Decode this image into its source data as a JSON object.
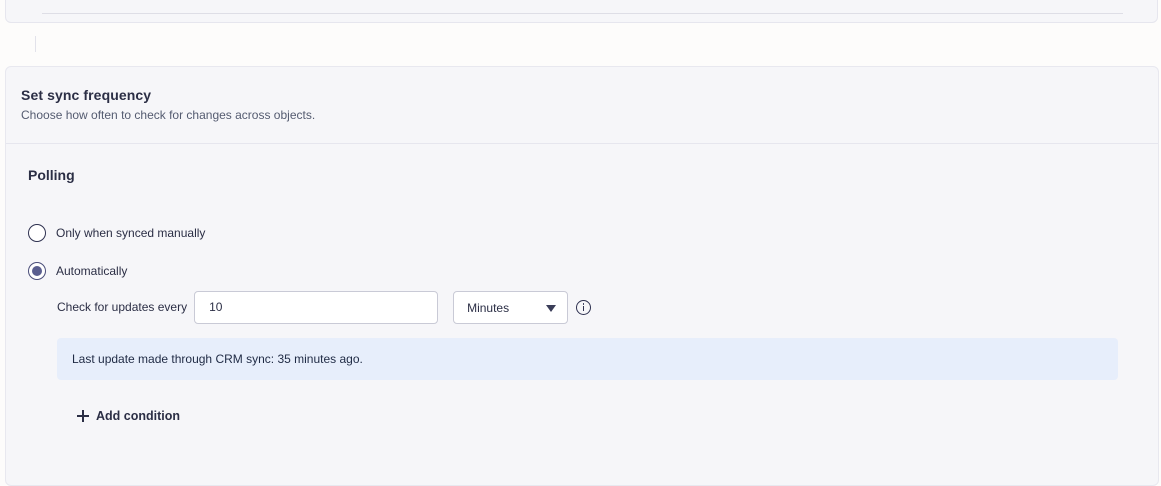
{
  "sync": {
    "title": "Set sync frequency",
    "subtitle": "Choose how often to check for changes across objects."
  },
  "polling": {
    "title": "Polling",
    "options": [
      {
        "label": "Only when synced manually",
        "selected": false
      },
      {
        "label": "Automatically",
        "selected": true
      }
    ],
    "frequency": {
      "label": "Check for updates every",
      "value": "10",
      "unit": "Minutes"
    },
    "notice": "Last update made through CRM sync: 35 minutes ago.",
    "add_condition_label": "Add condition"
  },
  "icons": {
    "info": "info-icon",
    "plus": "plus-icon",
    "caret": "chevron-down-icon"
  }
}
